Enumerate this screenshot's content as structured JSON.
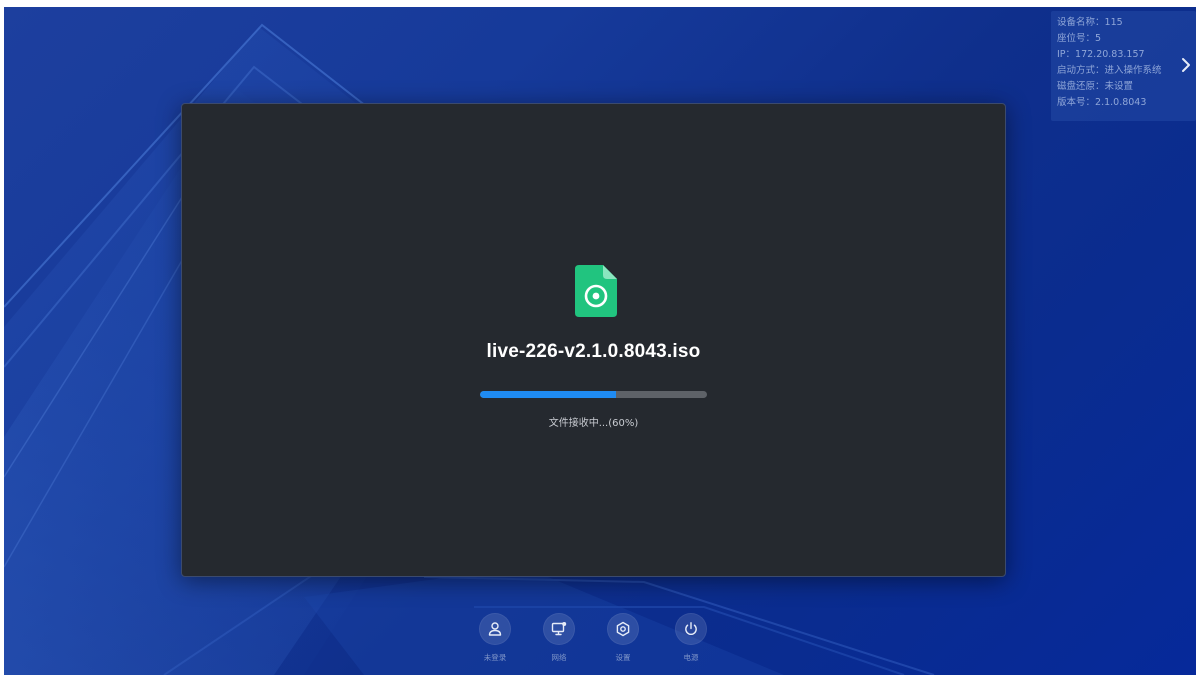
{
  "device_info": {
    "lines": [
      {
        "label": "设备名称",
        "value": "115"
      },
      {
        "label": "座位号",
        "value": "5"
      },
      {
        "label": "IP",
        "value": "172.20.83.157"
      },
      {
        "label": "启动方式",
        "value": "进入操作系统"
      },
      {
        "label": "磁盘还原",
        "value": "未设置"
      },
      {
        "label": "版本号",
        "value": "2.1.0.8043"
      }
    ],
    "separator": "：",
    "expand_icon": "chevron-right-icon"
  },
  "transfer": {
    "file_icon": "disc-image-file-icon",
    "file_name": "live-226-v2.1.0.8043.iso",
    "progress": 0.6,
    "status_text": "文件接收中...(60%)"
  },
  "dock": {
    "items": [
      {
        "id": "login",
        "icon": "user-icon",
        "label": "未登录"
      },
      {
        "id": "network",
        "icon": "network-icon",
        "label": "网络"
      },
      {
        "id": "settings",
        "icon": "gear-icon",
        "label": "设置"
      },
      {
        "id": "power",
        "icon": "power-icon",
        "label": "电源"
      }
    ]
  },
  "colors": {
    "desktop_blue": "#0a2c8f",
    "dialog_bg": "#25292f",
    "progress_fill": "#1f8bf2",
    "progress_track": "#5e6268",
    "file_icon_green": "#21c47f"
  }
}
